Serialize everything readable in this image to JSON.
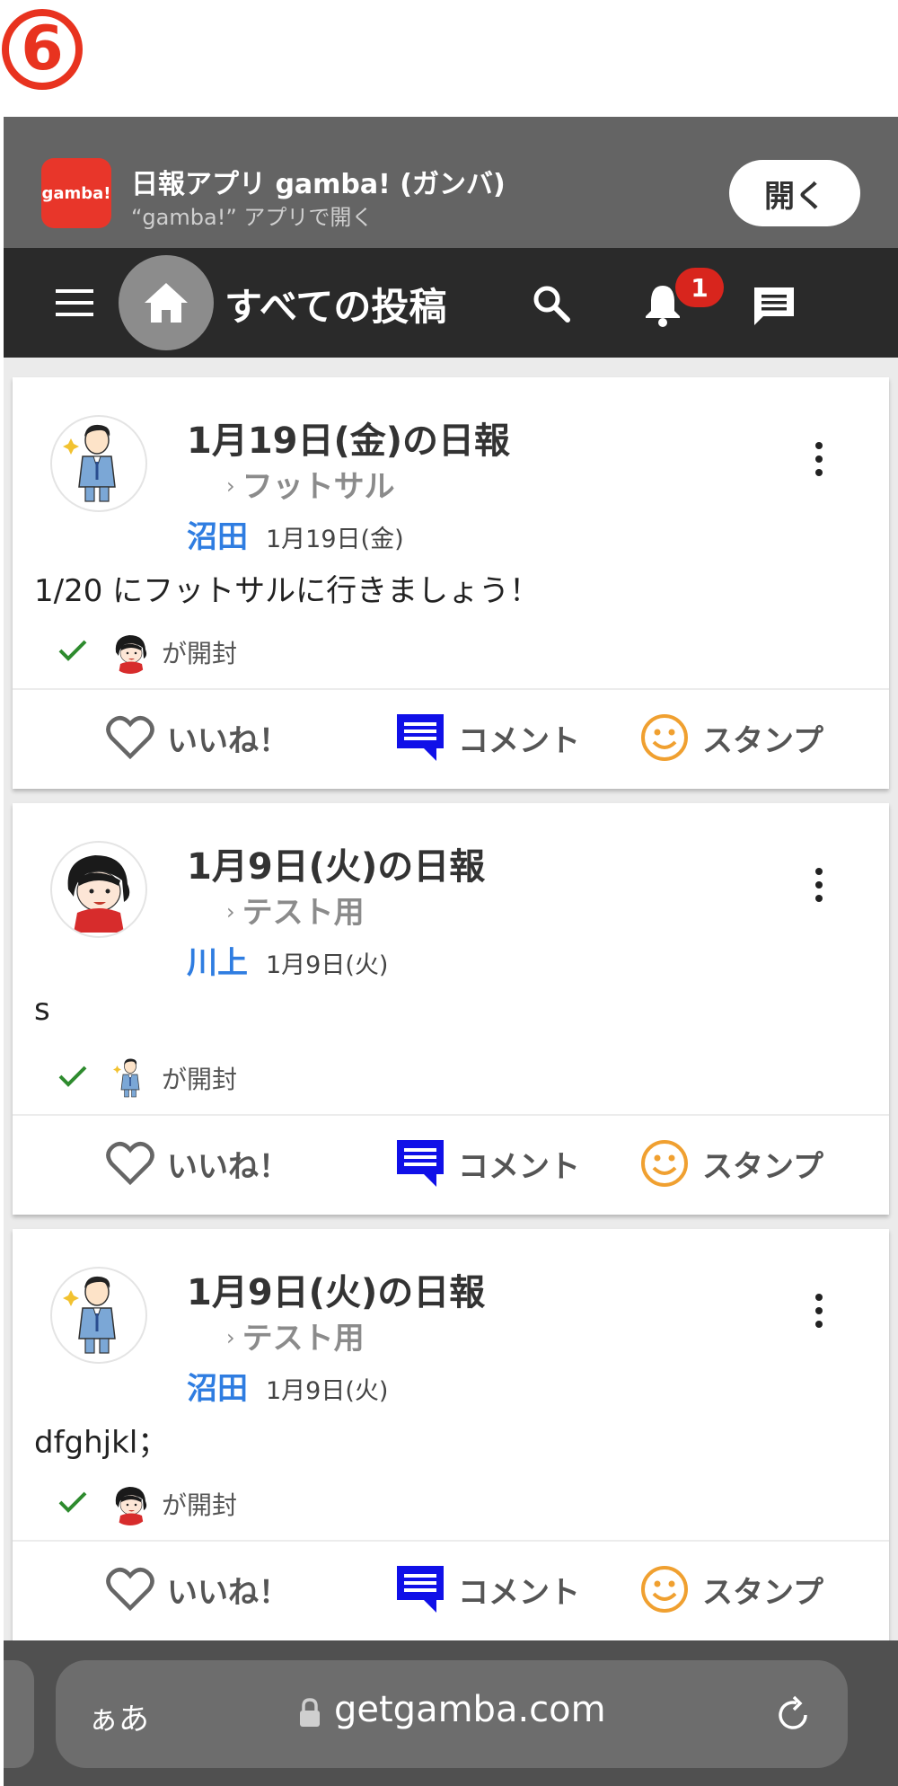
{
  "step_marker": "6",
  "smart_banner": {
    "app_icon_text": "gamba!",
    "title": "日報アプリ gamba! (ガンバ)",
    "subtitle": "“gamba!” アプリで開く",
    "open_label": "開く"
  },
  "app_bar": {
    "title": "すべての投稿",
    "notification_count": "1"
  },
  "posts": [
    {
      "title": "1月19日(金)の日報",
      "group": "フットサル",
      "author": "沼田",
      "date": "1月19日(金)",
      "body": "1/20 にフットサルに行きましょう！",
      "read_label": "が開封"
    },
    {
      "title": "1月9日(火)の日報",
      "group": "テスト用",
      "author": "川上",
      "date": "1月9日(火)",
      "body": "s",
      "read_label": "が開封"
    },
    {
      "title": "1月9日(火)の日報",
      "group": "テスト用",
      "author": "沼田",
      "date": "1月9日(火)",
      "body": "dfghjkl；",
      "read_label": "が開封"
    }
  ],
  "actions": {
    "like": "いいね！",
    "comment": "コメント",
    "stamp": "スタンプ"
  },
  "browser": {
    "text_size_label": "ぁあ",
    "url": "getgamba.com"
  },
  "colors": {
    "accent_red": "#e8331f",
    "author_blue": "#2f7de1",
    "comment_blue": "#1010e8",
    "stamp_orange": "#f0a030",
    "check_green": "#2e8b2e"
  }
}
